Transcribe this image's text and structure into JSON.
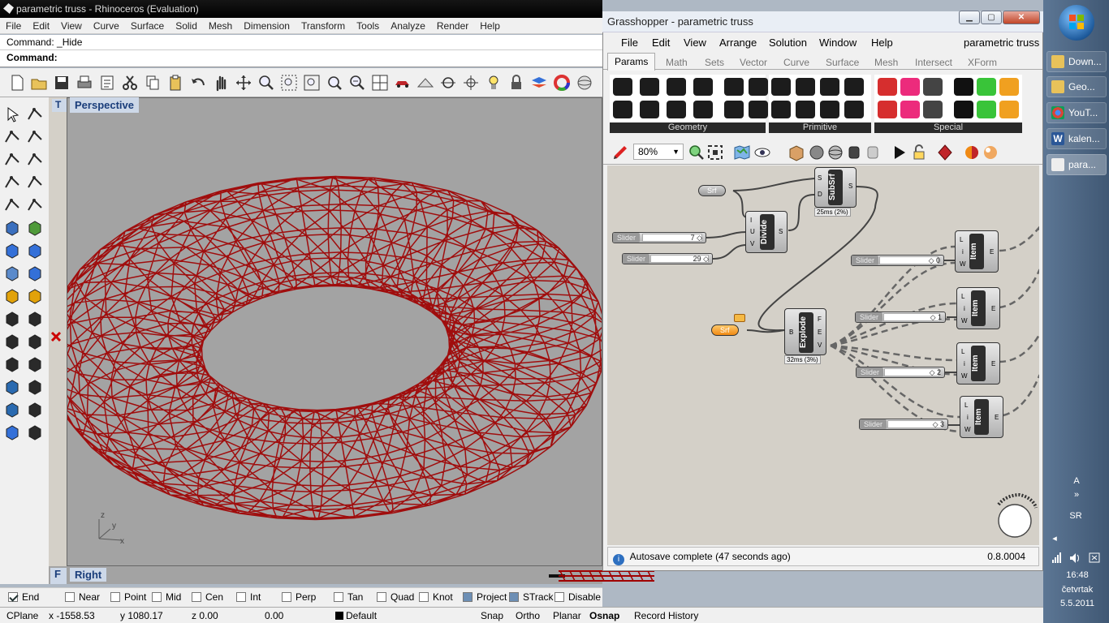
{
  "rhino": {
    "title": "parametric truss - Rhinoceros (Evaluation)",
    "menu": [
      "File",
      "Edit",
      "View",
      "Curve",
      "Surface",
      "Solid",
      "Mesh",
      "Dimension",
      "Transform",
      "Tools",
      "Analyze",
      "Render",
      "Help"
    ],
    "command_history": "Command: _Hide",
    "command_prompt": "Command:",
    "viewport_label": "Perspective",
    "viewport_tab_right": "Right",
    "viewport_tab_top": "T",
    "viewport_tab_front": "F",
    "axis_x": "x",
    "axis_y": "y",
    "axis_z": "z",
    "truss_color": "#a00000",
    "osnaps": [
      {
        "label": "End",
        "checked": true
      },
      {
        "label": "Near",
        "checked": false
      },
      {
        "label": "Point",
        "checked": false
      },
      {
        "label": "Mid",
        "checked": false
      },
      {
        "label": "Cen",
        "checked": false
      },
      {
        "label": "Int",
        "checked": false
      },
      {
        "label": "Perp",
        "checked": false
      },
      {
        "label": "Tan",
        "checked": false
      },
      {
        "label": "Quad",
        "checked": false
      },
      {
        "label": "Knot",
        "checked": false
      },
      {
        "label": "Project",
        "checked": false
      },
      {
        "label": "STrack",
        "checked": false
      },
      {
        "label": "Disable",
        "checked": false
      }
    ],
    "status": {
      "cplane": "CPlane",
      "x": "x -1558.53",
      "y": "y 1080.17",
      "z": "z 0.00",
      "dist": "0.00",
      "layer": "Default",
      "snap": "Snap",
      "ortho": "Ortho",
      "planar": "Planar",
      "osnap": "Osnap",
      "record_history": "Record History"
    }
  },
  "grasshopper": {
    "title": "Grasshopper - parametric truss",
    "document_name": "parametric truss",
    "menu": [
      "File",
      "Edit",
      "View",
      "Arrange",
      "Solution",
      "Window",
      "Help"
    ],
    "tabs": [
      "Params",
      "Math",
      "Sets",
      "Vector",
      "Curve",
      "Surface",
      "Mesh",
      "Intersect",
      "XForm"
    ],
    "active_tab": "Params",
    "panels": [
      "Geometry",
      "Primitive",
      "Special"
    ],
    "zoom": "80%",
    "components": {
      "srf1": "Srf",
      "srf2": "Srf",
      "divide": "Divide",
      "subsrf": "SubSrf",
      "explode": "Explode",
      "item": "Item",
      "subsrf_time": "25ms (2%)",
      "explode_time": "32ms (3%)"
    },
    "sliders": [
      {
        "name": "Slider",
        "value": "7"
      },
      {
        "name": "Slider",
        "value": "29"
      },
      {
        "name": "Slider",
        "value": "0"
      },
      {
        "name": "Slider",
        "value": "1"
      },
      {
        "name": "Slider",
        "value": "2"
      },
      {
        "name": "Slider",
        "value": "3"
      }
    ],
    "ports": {
      "s": "S",
      "d": "D",
      "i": "I",
      "u": "U",
      "v": "V",
      "b": "B",
      "f": "F",
      "e": "E",
      "l": "L",
      "w": "W"
    },
    "status_message": "Autosave complete (47 seconds ago)",
    "version": "0.8.0004"
  },
  "taskbar": {
    "items": [
      "Down...",
      "Geo...",
      "YouT...",
      "kalen...",
      "para..."
    ],
    "lang": "A",
    "lang_code": "SR",
    "time": "16:48",
    "day": "četvrtak",
    "date": "5.5.2011"
  }
}
